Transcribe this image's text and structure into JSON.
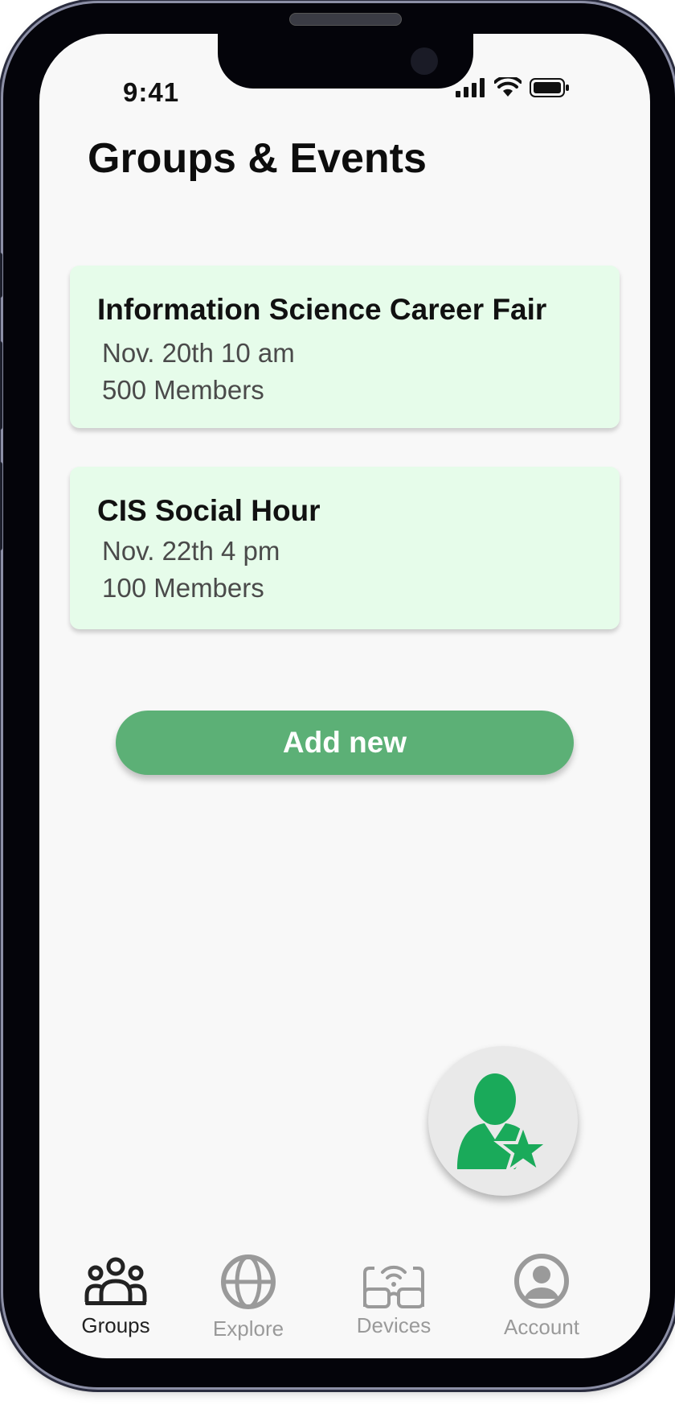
{
  "status_bar": {
    "time": "9:41",
    "icons": [
      "signal-icon",
      "wifi-icon",
      "battery-icon"
    ]
  },
  "page": {
    "title": "Groups & Events"
  },
  "events": [
    {
      "title": "Information Science Career Fair",
      "date": "Nov. 20th 10 am",
      "members": "500 Members"
    },
    {
      "title": "CIS Social Hour",
      "date": "Nov. 22th 4 pm",
      "members": "100 Members"
    }
  ],
  "actions": {
    "add_label": "Add new",
    "fab_icon": "user-star-icon"
  },
  "tabbar": {
    "items": [
      {
        "label": "Groups",
        "icon": "groups-icon",
        "active": true
      },
      {
        "label": "Explore",
        "icon": "globe-icon",
        "active": false
      },
      {
        "label": "Devices",
        "icon": "smart-glasses-icon",
        "active": false
      },
      {
        "label": "Account",
        "icon": "account-circle-icon",
        "active": false
      }
    ]
  },
  "colors": {
    "card_bg": "#e6fcea",
    "accent": "#5cb076",
    "icon_green": "#1aaa5a",
    "inactive": "#9a9a9a"
  }
}
